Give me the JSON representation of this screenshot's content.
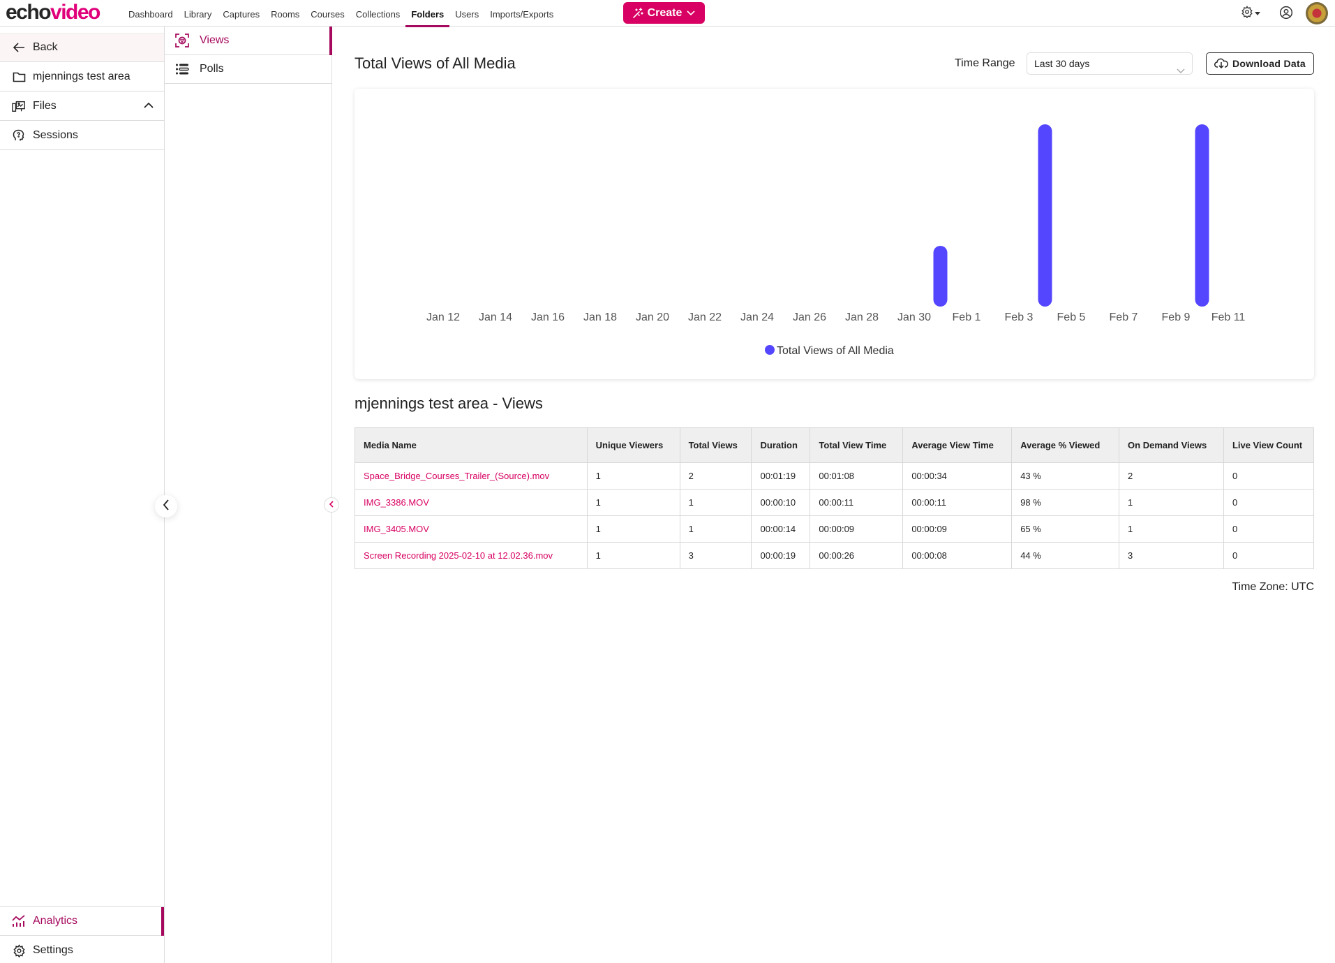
{
  "header": {
    "logo": {
      "part1": "echo",
      "part2": "video"
    },
    "nav": [
      {
        "label": "Dashboard",
        "active": false
      },
      {
        "label": "Library",
        "active": false
      },
      {
        "label": "Captures",
        "active": false
      },
      {
        "label": "Rooms",
        "active": false
      },
      {
        "label": "Courses",
        "active": false
      },
      {
        "label": "Collections",
        "active": false
      },
      {
        "label": "Folders",
        "active": true
      },
      {
        "label": "Users",
        "active": false
      },
      {
        "label": "Imports/Exports",
        "active": false
      }
    ],
    "create_label": "Create",
    "icons": [
      "settings-gear-icon",
      "user-profile-icon",
      "avatar"
    ]
  },
  "sidebar": {
    "back_label": "Back",
    "folder_label": "mjennings test area",
    "files_label": "Files",
    "sessions_label": "Sessions",
    "analytics_label": "Analytics",
    "settings_label": "Settings"
  },
  "subnav": {
    "views_label": "Views",
    "polls_label": "Polls"
  },
  "colors": {
    "brand": "#d80062",
    "accent": "#a5085d",
    "bar": "#5446ff"
  },
  "main": {
    "title": "Total Views of All Media",
    "time_range_label": "Time Range",
    "time_range_value": "Last 30 days",
    "download_label": "Download Data",
    "table_title": "mjennings test area - Views",
    "timezone": "Time Zone: UTC"
  },
  "chart_data": {
    "type": "bar",
    "title": "Total Views of All Media",
    "xlabel": "",
    "ylabel": "",
    "x_tick_labels": [
      "Jan 12",
      "Jan 14",
      "Jan 16",
      "Jan 18",
      "Jan 20",
      "Jan 22",
      "Jan 24",
      "Jan 26",
      "Jan 28",
      "Jan 30",
      "Feb 1",
      "Feb 3",
      "Feb 5",
      "Feb 7",
      "Feb 9",
      "Feb 11"
    ],
    "x_start": "Jan 12",
    "x_end": "Feb 11",
    "series": [
      {
        "name": "Total Views of All Media",
        "color": "#5446ff",
        "points": [
          {
            "date": "Jan 31",
            "day_index": 19,
            "value": 1
          },
          {
            "date": "Feb 4",
            "day_index": 23,
            "value": 3
          },
          {
            "date": "Feb 10",
            "day_index": 29,
            "value": 3
          }
        ]
      }
    ],
    "ylim": [
      0,
      3
    ],
    "grid": false,
    "legend": "bottom-center"
  },
  "table": {
    "columns": [
      "Media Name",
      "Unique Viewers",
      "Total Views",
      "Duration",
      "Total View Time",
      "Average View Time",
      "Average % Viewed",
      "On Demand Views",
      "Live View Count"
    ],
    "rows": [
      [
        "Space_Bridge_Courses_Trailer_(Source).mov",
        "1",
        "2",
        "00:01:19",
        "00:01:08",
        "00:00:34",
        "43 %",
        "2",
        "0"
      ],
      [
        "IMG_3386.MOV",
        "1",
        "1",
        "00:00:10",
        "00:00:11",
        "00:00:11",
        "98 %",
        "1",
        "0"
      ],
      [
        "IMG_3405.MOV",
        "1",
        "1",
        "00:00:14",
        "00:00:09",
        "00:00:09",
        "65 %",
        "1",
        "0"
      ],
      [
        "Screen Recording 2025-02-10 at 12.02.36.mov",
        "1",
        "3",
        "00:00:19",
        "00:00:26",
        "00:00:08",
        "44 %",
        "3",
        "0"
      ]
    ]
  }
}
